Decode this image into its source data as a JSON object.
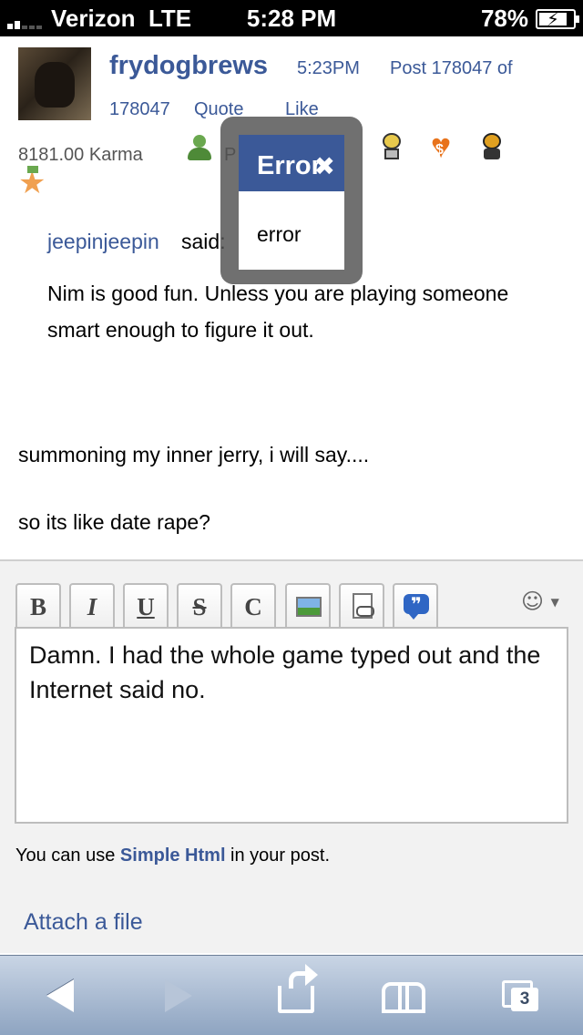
{
  "status_bar": {
    "carrier": "Verizon",
    "network": "LTE",
    "time": "5:28 PM",
    "battery": "78%",
    "battery_level": 0.78
  },
  "post": {
    "username": "frydogbrews",
    "time": "5:23PM",
    "post_number_line1": "Post 178047 of",
    "post_number_line2": "178047",
    "quote_label": "Quote",
    "like_label": "Like",
    "karma": "8181.00 Karma",
    "karma_trail": "P",
    "quote": {
      "author": "jeepinjeepin",
      "said": "said:",
      "text": "Nim is good fun. Unless you are playing someone smart enough to figure it out."
    },
    "body_line1": "summoning my inner jerry, i will say....",
    "body_line2": "so its like date rape?"
  },
  "badges": [
    "person-icon",
    "goggles-icon",
    "heart-money-icon",
    "hood-icon",
    "star-medal-icon"
  ],
  "error_modal": {
    "title": "Error",
    "message": "error"
  },
  "composer": {
    "toolbar": {
      "bold": "B",
      "italic": "I",
      "underline": "U",
      "strike": "S",
      "code": "C"
    },
    "text": "Damn. I had the whole game typed out and the Internet said no.",
    "hint_prefix": "You can use ",
    "hint_link": "Simple Html",
    "hint_suffix": " in your post.",
    "attach_label": "Attach a file"
  },
  "browser_toolbar": {
    "tab_count": "3"
  },
  "colors": {
    "link": "#3b5998",
    "modal_header": "#3b5998",
    "toolbar_gradient_top": "#c9d5e5",
    "toolbar_gradient_bottom": "#8ea4c1"
  }
}
